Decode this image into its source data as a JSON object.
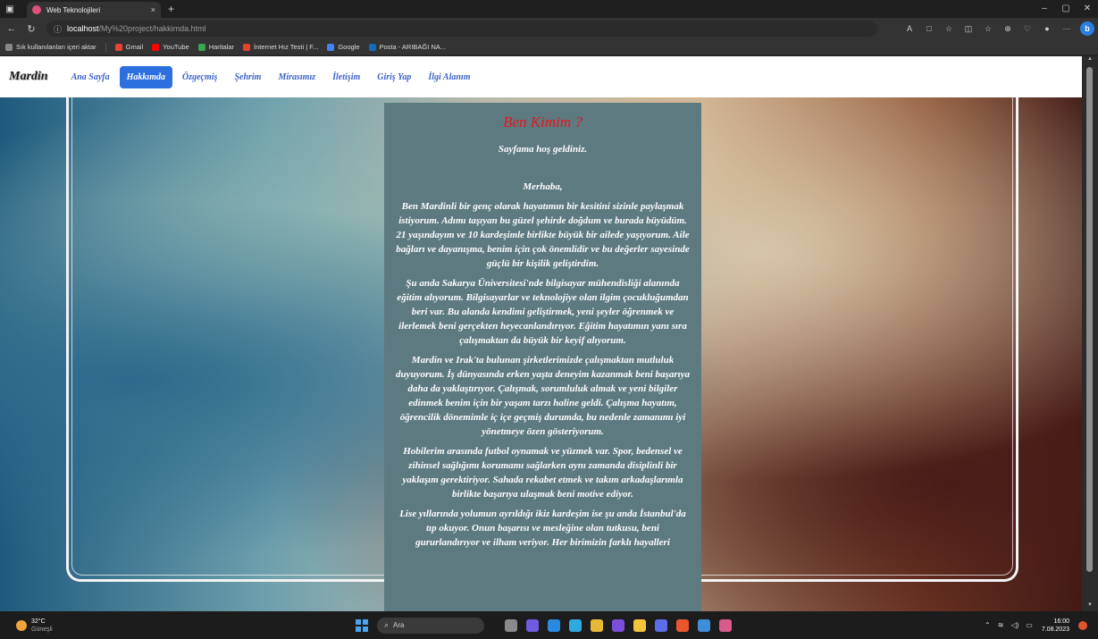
{
  "browser": {
    "tab_title": "Web Teknolojileri",
    "tab_close": "×",
    "new_tab": "+",
    "url_host": "localhost",
    "url_path": "/My%20project/hakkimda.html",
    "window_controls": {
      "minimize": "–",
      "restore": "▢",
      "close": "✕"
    },
    "toolbar_icons": [
      "A",
      "□",
      "☆",
      "◫",
      "☆",
      "⊕",
      "♡",
      "●",
      "···"
    ],
    "bing": "b"
  },
  "bookmarks": [
    {
      "label": "Sık kullanılanları içeri aktar",
      "color": "#888888"
    },
    {
      "label": "Gmail",
      "color": "#ea4335"
    },
    {
      "label": "YouTube",
      "color": "#ff0000"
    },
    {
      "label": "Haritalar",
      "color": "#34a853"
    },
    {
      "label": "İnternet Hız Testi | F...",
      "color": "#e8412c"
    },
    {
      "label": "Google",
      "color": "#4285f4"
    },
    {
      "label": "Posta - ARIBAĞI NA...",
      "color": "#0f6cbd"
    }
  ],
  "site": {
    "logo": "Mardin",
    "nav": [
      {
        "label": "Ana Sayfa",
        "active": false
      },
      {
        "label": "Hakkımda",
        "active": true
      },
      {
        "label": "Özgeçmiş",
        "active": false
      },
      {
        "label": "Şehrim",
        "active": false
      },
      {
        "label": "Mirasımız",
        "active": false
      },
      {
        "label": "İletişim",
        "active": false
      },
      {
        "label": "Giriş Yap",
        "active": false
      },
      {
        "label": "İlgi Alanım",
        "active": false
      }
    ],
    "heading": "Ben Kimim ?",
    "welcome": "Sayfama hoş geldiniz.",
    "paragraphs": [
      "Merhaba,",
      "Ben Mardinli bir genç olarak hayatımın bir kesitini sizinle paylaşmak istiyorum. Adımı taşıyan bu güzel şehirde doğdum ve burada büyüdüm. 21 yaşındayım ve 10 kardeşimle birlikte büyük bir ailede yaşıyorum. Aile bağları ve dayanışma, benim için çok önemlidir ve bu değerler sayesinde güçlü bir kişilik geliştirdim.",
      "Şu anda Sakarya Üniversitesi'nde bilgisayar mühendisliği alanında eğitim alıyorum. Bilgisayarlar ve teknolojiye olan ilgim çocukluğumdan beri var. Bu alanda kendimi geliştirmek, yeni şeyler öğrenmek ve ilerlemek beni gerçekten heyecanlandırıyor. Eğitim hayatımın yanı sıra çalışmaktan da büyük bir keyif alıyorum.",
      "Mardin ve Irak'ta bulunan şirketlerimizde çalışmaktan mutluluk duyuyorum. İş dünyasında erken yaşta deneyim kazanmak beni başarıya daha da yaklaştırıyor. Çalışmak, sorumluluk almak ve yeni bilgiler edinmek benim için bir yaşam tarzı haline geldi. Çalışma hayatım, öğrencilik dönemimle iç içe geçmiş durumda, bu nedenle zamanımı iyi yönetmeye özen gösteriyorum.",
      "Hobilerim arasında futbol oynamak ve yüzmek var. Spor, bedensel ve zihinsel sağlığımı korumamı sağlarken aynı zamanda disiplinli bir yaklaşım gerektiriyor. Sahada rekabet etmek ve takım arkadaşlarımla birlikte başarıya ulaşmak beni motive ediyor.",
      "Lise yıllarında yolumun ayrıldığı ikiz kardeşim ise şu anda İstanbul'da tıp okuyor. Onun başarısı ve mesleğine olan tutkusu, beni gururlandırıyor ve ilham veriyor. Her birimizin farklı hayalleri"
    ]
  },
  "taskbar": {
    "temperature": "32°C",
    "weather": "Güneşli",
    "search": "Ara",
    "app_colors": [
      "#8a8a8a",
      "#6f5be0",
      "#2b8ae0",
      "#2fa9e0",
      "#e8b838",
      "#7a4fd8",
      "#f2c53a",
      "#5b6de8",
      "#e8562e",
      "#3f8fd8",
      "#d85a8a"
    ],
    "time": "16:00",
    "date": "7.08.2023"
  }
}
